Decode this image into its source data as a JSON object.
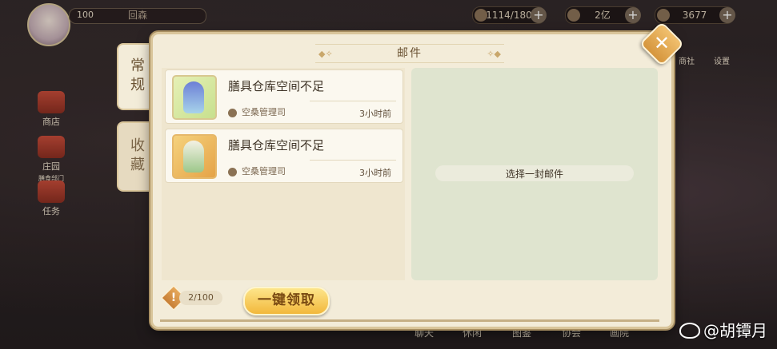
{
  "hud": {
    "level": "100",
    "player_name": "回森",
    "resources": [
      {
        "icon": "bowl-icon",
        "value": "1114/180"
      },
      {
        "icon": "feather-icon",
        "value": "2亿"
      },
      {
        "icon": "coin-icon",
        "value": "3677"
      }
    ]
  },
  "left_menu": [
    {
      "label": "商店",
      "icon": "shop-icon"
    },
    {
      "label": "庄园",
      "sub": "膳食部门",
      "icon": "manor-icon"
    },
    {
      "label": "任务",
      "icon": "task-icon"
    }
  ],
  "right_menu": [
    {
      "label": "商社",
      "icon": "bag-icon"
    },
    {
      "label": "设置",
      "icon": "gear-icon"
    }
  ],
  "bottom_nav": [
    "聊天",
    "休闲",
    "图鉴",
    "协会",
    "画院"
  ],
  "mail_dialog": {
    "title": "邮件",
    "tabs": [
      {
        "label": "常规",
        "active": true
      },
      {
        "label": "收藏",
        "active": false
      }
    ],
    "mails": [
      {
        "title": "膳具仓库空间不足",
        "sender": "空桑管理司",
        "time": "3小时前",
        "icon": "character-avatar-icon"
      },
      {
        "title": "膳具仓库空间不足",
        "sender": "空桑管理司",
        "time": "3小时前",
        "icon": "character-avatar-icon"
      }
    ],
    "empty_detail": "选择一封邮件",
    "count": "2/100",
    "claim_all": "一键领取"
  },
  "watermark": "@胡镡月",
  "colors": {
    "dialog_bg": "#f3ecd9",
    "button_gold": "#f2b83c",
    "frame": "#d9c59a"
  }
}
